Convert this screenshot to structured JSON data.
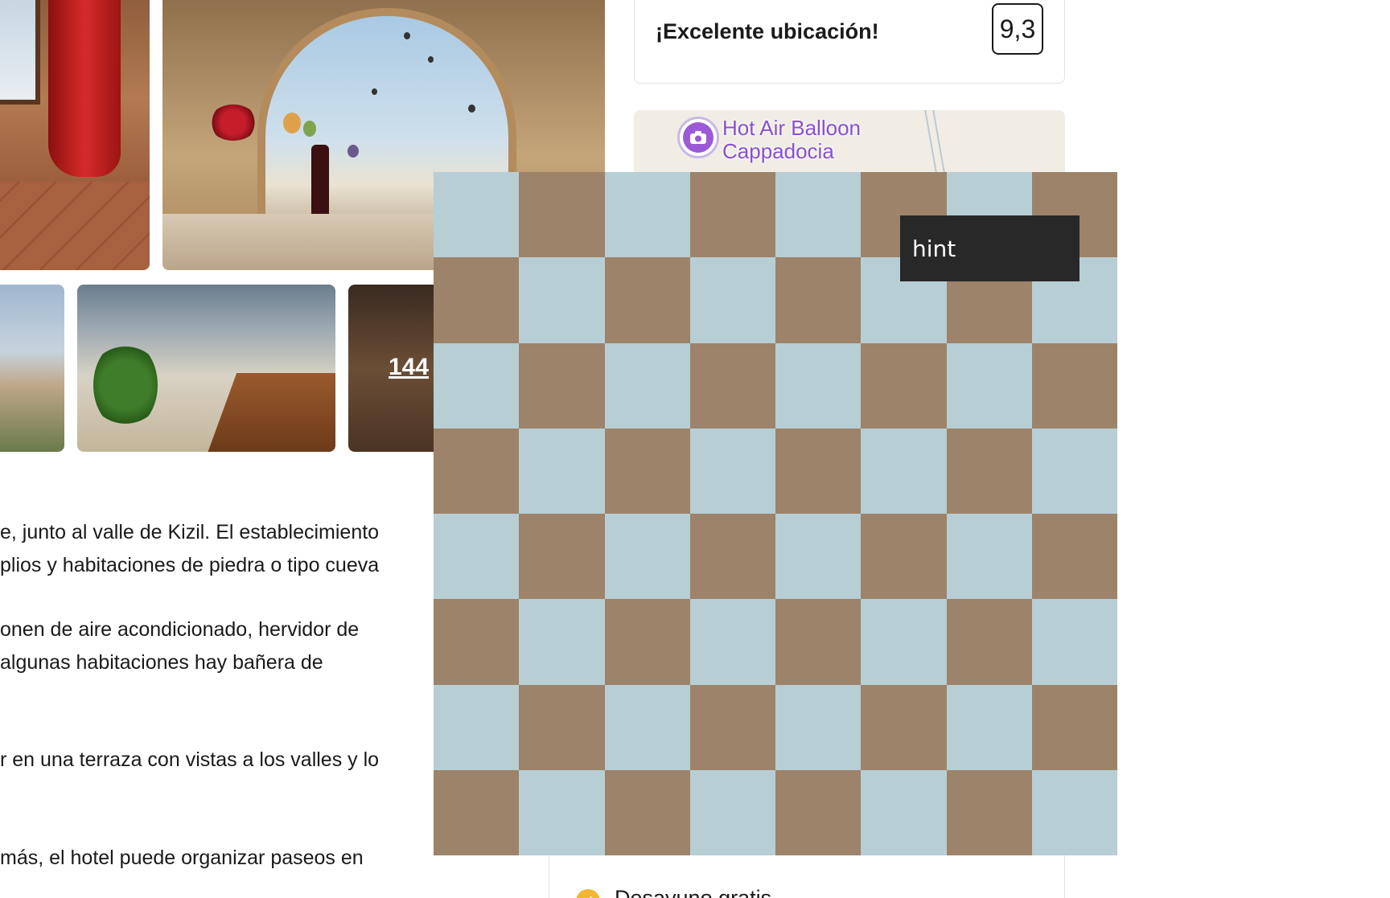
{
  "gallery": {
    "more_photos_label": "144"
  },
  "description": {
    "lines": [
      "e, junto al valle de Kizil. El establecimiento",
      "plios y habitaciones de piedra o tipo cueva",
      "onen de aire acondicionado, hervidor de",
      "algunas habitaciones hay bañera de",
      "r en una terraza con vistas a los valles y lo",
      "más, el hotel puede organizar paseos en"
    ]
  },
  "location": {
    "label": "¡Excelente ubicación!",
    "score": "9,3"
  },
  "map": {
    "poi_icon": "camera-icon",
    "poi_name_line1": "Hot Air Balloon",
    "poi_name_line2": "Cappadocia"
  },
  "facilities": {
    "breakfast_label": "Desayuno gratis",
    "breakfast_icon": "check-icon"
  },
  "board": {
    "light_color": "#b7ced5",
    "dark_color": "#9d8369",
    "hint_label": "hint"
  }
}
